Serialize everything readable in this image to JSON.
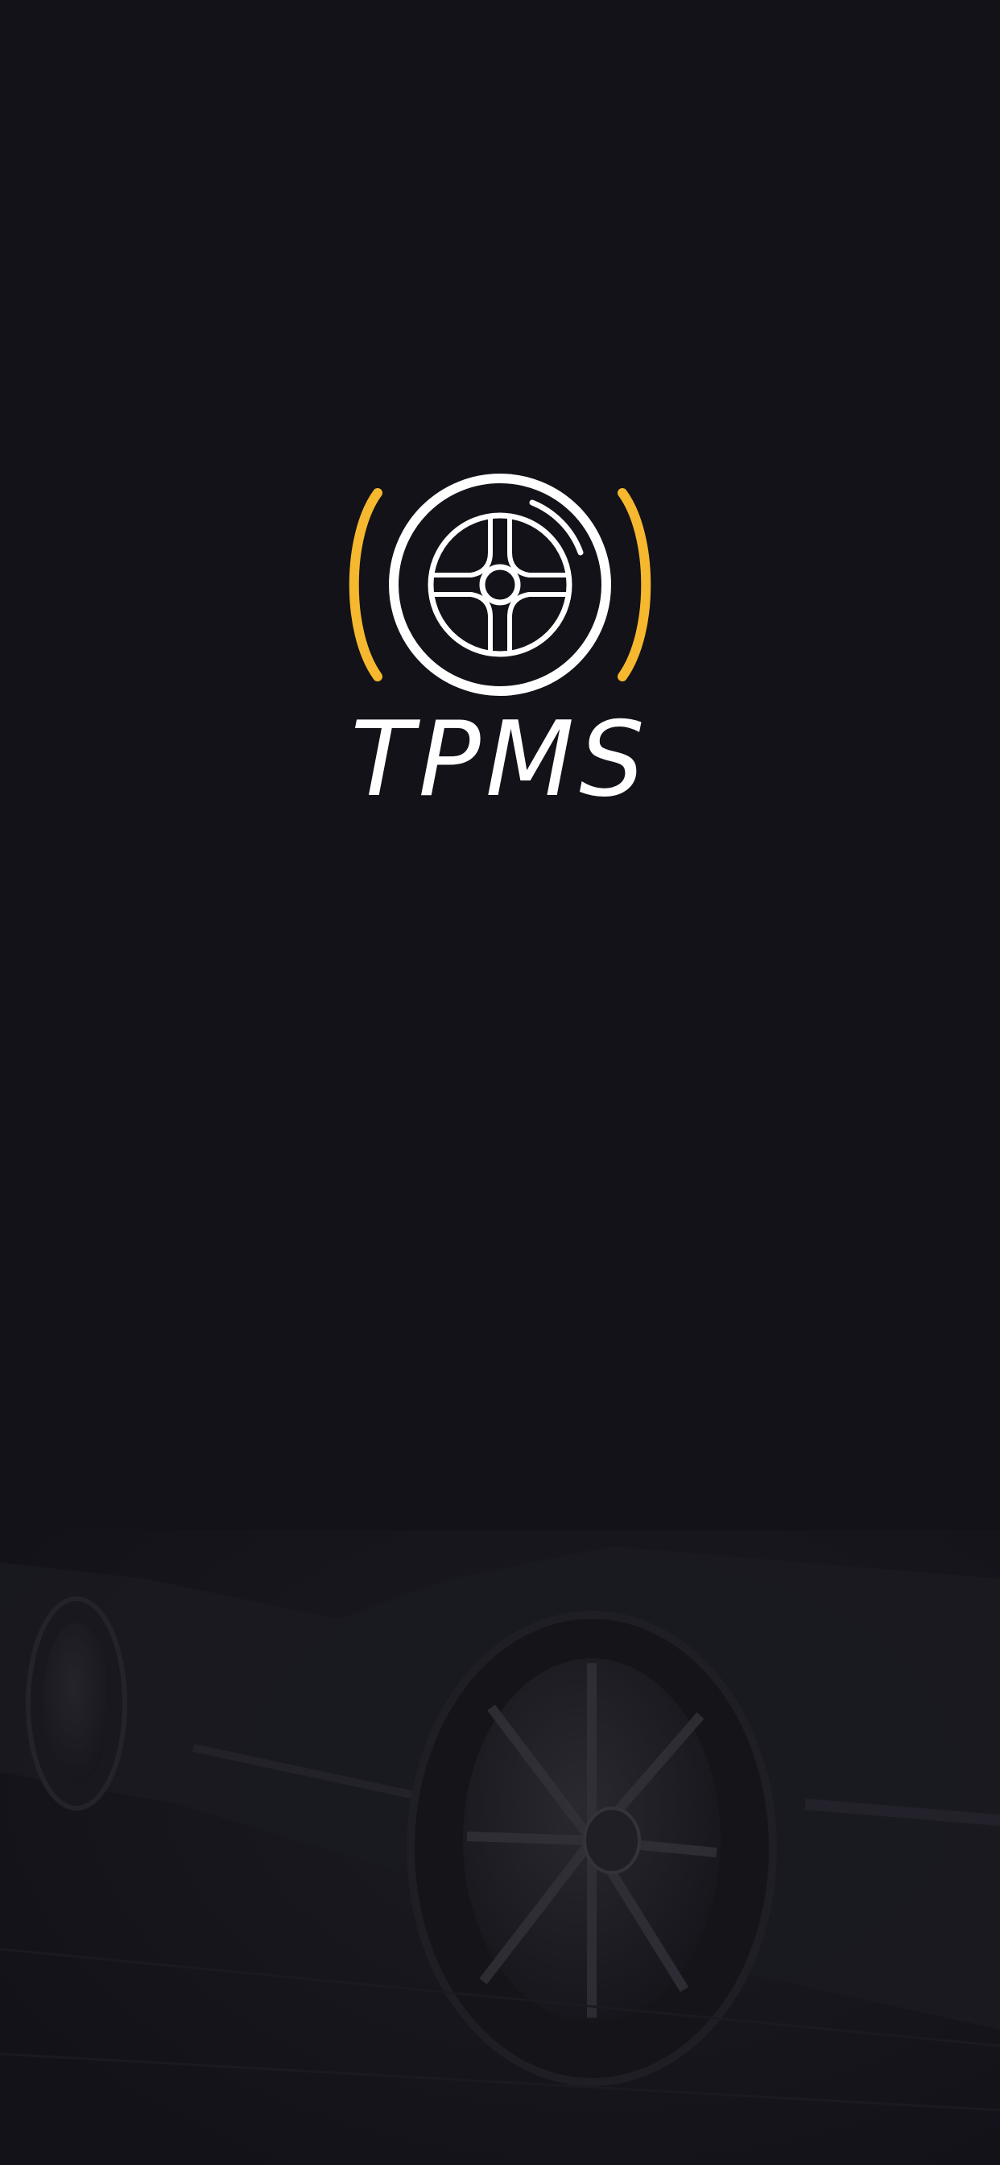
{
  "splash": {
    "title": "TPMS",
    "logo_icon": "tire-pressure-wheel-icon",
    "backdrop_image": "car-wheel-photo"
  },
  "colors": {
    "background": "#131219",
    "accent": "#F5B82E",
    "logo": "#FFFFFF"
  }
}
